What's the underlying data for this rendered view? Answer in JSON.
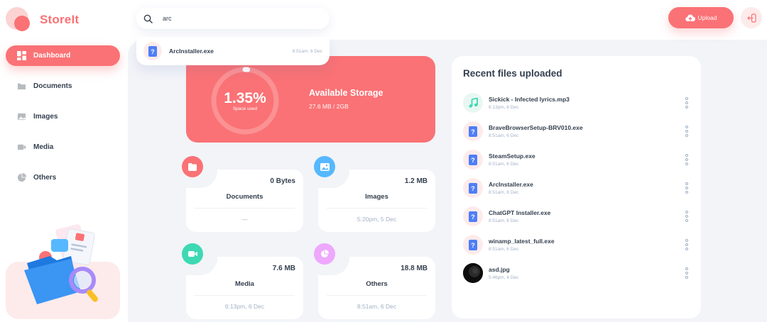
{
  "app": {
    "name": "StoreIt"
  },
  "sidebar": {
    "items": [
      {
        "label": "Dashboard",
        "active": true
      },
      {
        "label": "Documents",
        "active": false
      },
      {
        "label": "Images",
        "active": false
      },
      {
        "label": "Media",
        "active": false
      },
      {
        "label": "Others",
        "active": false
      }
    ]
  },
  "search": {
    "value": "arc",
    "results": [
      {
        "name": "ArcInstaller.exe",
        "date": "8:51am, 6 Dec"
      }
    ]
  },
  "header": {
    "upload_label": "Upload"
  },
  "storage": {
    "percent": "1.35%",
    "percent_value": 1.35,
    "subtitle": "Space used",
    "title": "Available Storage",
    "amount": "27.6 MB / 2GB"
  },
  "summary": [
    {
      "title": "Documents",
      "size": "0 Bytes",
      "date": "—",
      "color": "#fa7275",
      "icon": "folder-icon"
    },
    {
      "title": "Images",
      "size": "1.2 MB",
      "date": "5:20pm, 5 Dec",
      "color": "#56b8ff",
      "icon": "image-icon"
    },
    {
      "title": "Media",
      "size": "7.6 MB",
      "date": "6:13pm, 6 Dec",
      "color": "#3dd9b3",
      "icon": "video-icon"
    },
    {
      "title": "Others",
      "size": "18.8 MB",
      "date": "8:51am, 6 Dec",
      "color": "#eea8fd",
      "icon": "pie-icon"
    }
  ],
  "recent": {
    "title": "Recent files uploaded",
    "files": [
      {
        "name": "Sickick - Infected lyrics.mp3",
        "date": "6:13pm, 6 Dec",
        "type": "music"
      },
      {
        "name": "BraveBrowserSetup-BRV010.exe",
        "date": "8:51am, 6 Dec",
        "type": "file"
      },
      {
        "name": "SteamSetup.exe",
        "date": "8:51am, 6 Dec",
        "type": "file"
      },
      {
        "name": "ArcInstaller.exe",
        "date": "8:51am, 6 Dec",
        "type": "file"
      },
      {
        "name": "ChatGPT Installer.exe",
        "date": "8:51am, 6 Dec",
        "type": "file"
      },
      {
        "name": "winamp_latest_full.exe",
        "date": "8:51am, 6 Dec",
        "type": "file"
      },
      {
        "name": "asd.jpg",
        "date": "5:46pm, 4 Dec",
        "type": "image"
      }
    ]
  },
  "colors": {
    "brand": "#fa7275",
    "text": "#333f4e",
    "muted": "#a3b2c7",
    "panel": "#f2f4f8"
  }
}
